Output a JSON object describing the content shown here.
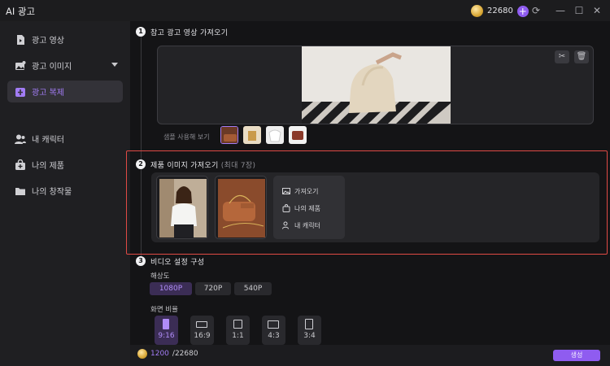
{
  "window": {
    "title": "AI 광고",
    "credits": "22680",
    "plus": "+"
  },
  "colors": {
    "accent": "#8f5cf0",
    "highlight_frame": "#e04a45",
    "selected_text": "#a27cf5"
  },
  "sidebar": {
    "items": [
      {
        "label": "광고 영상",
        "icon": "video-icon"
      },
      {
        "label": "광고 이미지",
        "icon": "image-icon"
      },
      {
        "label": "광고 복제",
        "icon": "clone-icon",
        "active": true
      },
      {
        "label": "내 캐릭터",
        "icon": "character-icon"
      },
      {
        "label": "나의 제품",
        "icon": "product-bag-icon"
      },
      {
        "label": "나의 창작물",
        "icon": "folder-icon"
      }
    ]
  },
  "step1": {
    "num": "1",
    "title": "참고 광고 영상 가져오기",
    "sample_label": "샘플 사용해 보기"
  },
  "step2": {
    "num": "2",
    "title": "제품 이미지 가져오기",
    "hint": "(최대 7장)",
    "import_options": [
      "가져오기",
      "나의 제품",
      "내 캐릭터"
    ]
  },
  "step3": {
    "num": "3",
    "title": "비디오 설정 구성",
    "resolution_label": "해상도",
    "resolutions": [
      "1080P",
      "720P",
      "540P"
    ],
    "resolution_selected": "1080P",
    "ratio_label": "화면 비율",
    "ratios": [
      "9:16",
      "16:9",
      "1:1",
      "4:3",
      "3:4"
    ],
    "ratio_selected": "9:16"
  },
  "footer": {
    "cost_used": "1200",
    "cost_total": "/22680",
    "generate_label": "생성"
  }
}
